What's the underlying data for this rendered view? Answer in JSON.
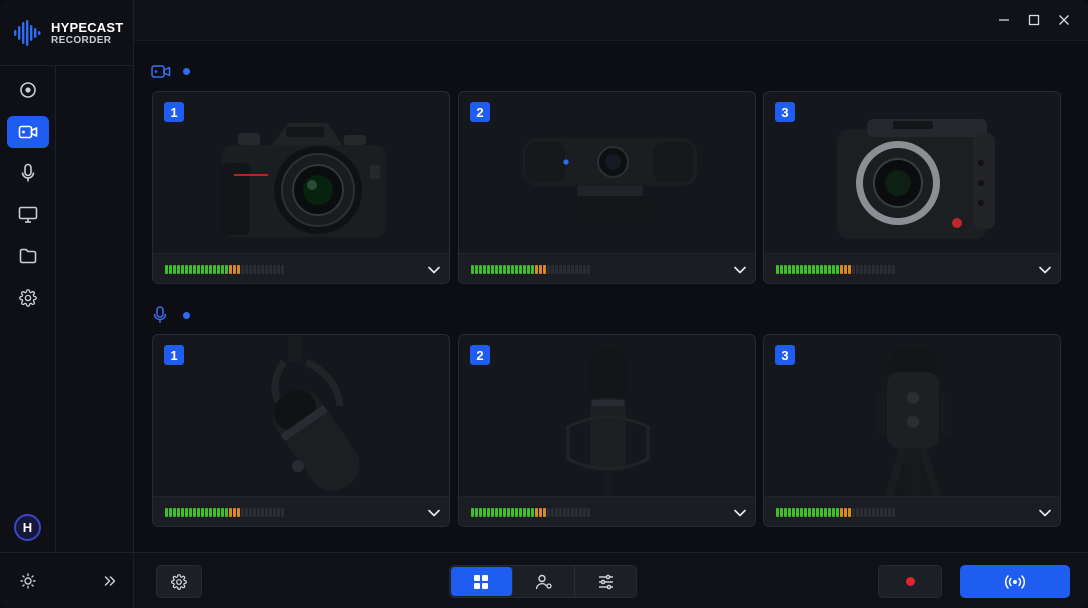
{
  "brand": {
    "name": "HYPECAST",
    "sub": "RECORDER"
  },
  "nav": [
    {
      "icon": "record-icon",
      "label": "Record"
    },
    {
      "icon": "video-camera-icon",
      "label": "Cameras"
    },
    {
      "icon": "microphone-icon",
      "label": "Microphones"
    },
    {
      "icon": "monitor-icon",
      "label": "Screen"
    },
    {
      "icon": "folder-icon",
      "label": "Files"
    },
    {
      "icon": "gear-icon",
      "label": "Settings"
    }
  ],
  "active_nav": "Cameras",
  "user": {
    "initial": "H"
  },
  "cameras": [
    {
      "number": "1",
      "device": "mirrorless-camera",
      "level": 0.62
    },
    {
      "number": "2",
      "device": "webcam",
      "level": 0.62
    },
    {
      "number": "3",
      "device": "cinema-camera",
      "level": 0.62
    }
  ],
  "microphones": [
    {
      "number": "1",
      "device": "dynamic-microphone",
      "level": 0.62
    },
    {
      "number": "2",
      "device": "condenser-microphone",
      "level": 0.62
    },
    {
      "number": "3",
      "device": "usb-microphone",
      "level": 0.62
    }
  ],
  "colors": {
    "accent": "#1f5cf0",
    "meter_green": "#3fbf2a",
    "meter_orange": "#d88a1e",
    "record_red": "#e0242f"
  },
  "bottom": {
    "active_view": "grid"
  }
}
